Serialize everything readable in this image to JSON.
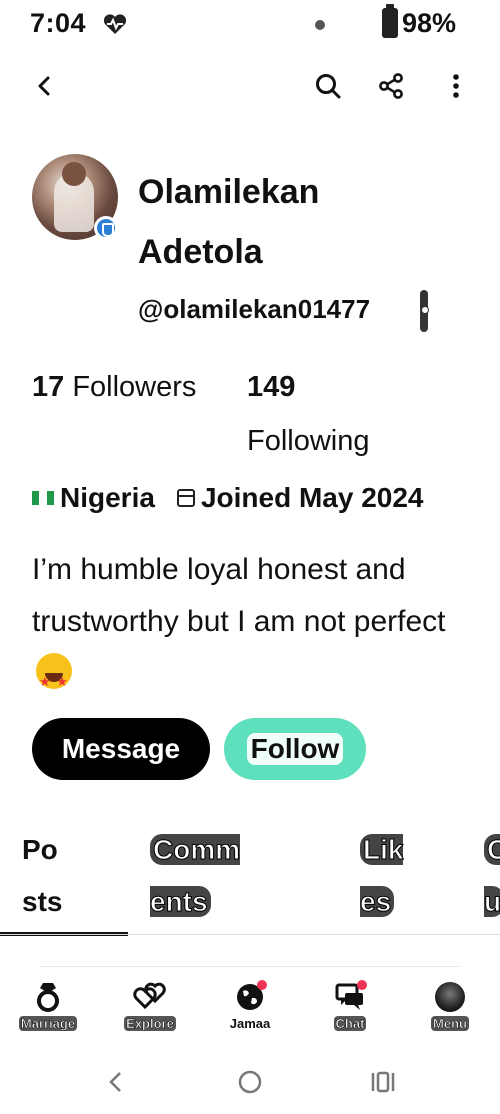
{
  "status_bar": {
    "time": "7:04",
    "battery": "98%"
  },
  "top_bar": {
    "back_icon": "chevron-left-icon",
    "search_icon": "search-icon",
    "share_icon": "share-icon",
    "more_icon": "more-vertical-icon"
  },
  "profile": {
    "name": "Olamilekan Adetola",
    "handle": "@olamilekan01477",
    "followers_count": "17",
    "followers_label": "Followers",
    "following_count": "149",
    "following_label": "Following",
    "country": "Nigeria",
    "joined": "Joined May 2024",
    "bio": "I’m humble loyal honest and trustworthy but I am not perfect"
  },
  "actions": {
    "message_label": "Message",
    "follow_label": "Follow"
  },
  "tabs": [
    {
      "label": "Po sts",
      "selected": true
    },
    {
      "label": "Comm ents",
      "selected": false
    },
    {
      "label": "Lik es",
      "selected": false
    },
    {
      "label": "C u",
      "selected": false
    }
  ],
  "bottom_nav": [
    {
      "label": "Marriage",
      "icon": "ring-icon"
    },
    {
      "label": "Explore",
      "icon": "hearts-icon"
    },
    {
      "label": "Jamaa",
      "icon": "globe-icon"
    },
    {
      "label": "Chat",
      "icon": "chat-icon"
    },
    {
      "label": "Menu",
      "icon": "avatar-icon"
    }
  ],
  "colors": {
    "follow_button": "#5fe0bc",
    "message_button": "#000000",
    "notification_badge": "#ee3355",
    "nigeria_green": "#1f9a4a"
  }
}
